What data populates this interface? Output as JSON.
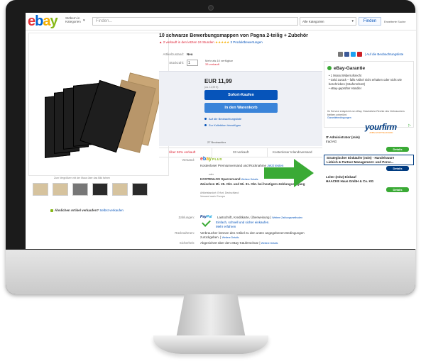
{
  "header": {
    "logo": {
      "e": "e",
      "b": "b",
      "a": "a",
      "y": "y"
    },
    "categories_label": "Stöbern in Kategorien",
    "search_placeholder": "Finden...",
    "category_select": "Alle Kategorien",
    "find_button": "Finden",
    "advanced_search": "Erweiterte Suche"
  },
  "gallery": {
    "hint": "Zum Vergrößern mit der Maus über das Bild fahren",
    "sell_text": "Ähnlichen Artikel verkaufen?",
    "sell_link": "Selbst verkaufen"
  },
  "listing": {
    "title": "10 schwarze Bewerbungsmappen von Pagna 2-teilig + Zubehör",
    "sold_recent": "2 verkauft in den letzten 24 Stunden",
    "stars": "★★★★★",
    "reviews_link": "3 Produktbewertungen",
    "condition_label": "Artikelzustand:",
    "condition_value": "Neu",
    "quantity_label": "Stückzahl:",
    "quantity_value": "1",
    "available": "Mehr als 10 verfügbar",
    "sold_count": "33 verkauft",
    "price": "EUR 11,99",
    "approx": "(ca. 11,99 €)",
    "buy_now": "Sofort-Kaufen",
    "add_to_cart": "In den Warenkorb",
    "watchlist": "Auf die Beobachtungsliste",
    "add_collection": "Zur Kollektion hinzufügen",
    "watchers": "27 Beobachter"
  },
  "stats": {
    "sold_percent": "Über 92% verkauft",
    "sold": "33 verkauft",
    "shipping": "Kostenloser Inlandsversand"
  },
  "shipping": {
    "label": "Versand:",
    "plus": "PLUS",
    "premium_text": "Kostenloser Premiumversand und Rücknahme",
    "learn_more": "Jetzt testen",
    "or": "oder",
    "free_standard": "KOSTENLOS  Sparversand",
    "details": "Weitere Details",
    "delivery": "Zwischen Mi. 25. Okt. und Mi. 31. Okt. bei heutigem Zahlungseingang",
    "location": "Artikelstandort: Erfurt, Deutschland",
    "ships_to": "Versand nach: Europa"
  },
  "payment": {
    "label": "Zahlungen:",
    "paypal_1": "Pay",
    "paypal_2": "Pal",
    "methods": "Lastschrift,  Kreditkarte,  Überweisung",
    "more": "Weitere Zahlungsmethoden",
    "secure_1": "Einfach, schnell und sicher einkaufen.",
    "secure_2": "Mehr erfahren"
  },
  "returns": {
    "label": "Rücknahmen:",
    "text": "Verbraucher können den Artikel zu den unten angegebenen Bedingungen zurückgeben.",
    "details": "Weitere Details"
  },
  "security": {
    "label": "Sicherheit:",
    "text": "Abgesichert über den eBay-Käuferschutz",
    "details": "Weitere Details"
  },
  "sidebar": {
    "watchlist_link": "Auf die Beobachtungsliste",
    "guarantee_title": "eBay-Garantie",
    "guarantee_items": [
      "• 1 Monat Widerrufsrecht",
      "• Geld zurück – falls Artikel nicht erhalten oder nicht wie beschrieben (Käuferschutz)",
      "• eBay-geprüfter Händler"
    ],
    "guarantee_footer": "Ihr Service entspricht von eBay. Gesetzliche Rechte des Verbrauchers bleiben unberührt.",
    "guarantee_link": "Garantiebedingungen",
    "ad_logo": "yourfirm",
    "ad_sub": "JOBS IM MITTELSTAND",
    "jobs": [
      {
        "title": "IT-Administrator (m/w)",
        "company": "trad AG",
        "button": "Details"
      },
      {
        "title": "Strategischer Einkäufer (m/w) - Handelsware",
        "company": "Liebich & Partner Management- und Perso...",
        "button": "Details"
      },
      {
        "title": "Leiter (m/w) Einkauf",
        "company": "HAACKE Haus GmbH & Co. KG",
        "button": "Details"
      }
    ]
  },
  "colors": {
    "ebay_red": "#e53238",
    "ebay_blue": "#0064d2",
    "ebay_yellow": "#f5af02",
    "ebay_green": "#86b817",
    "buy_button": "#0654ba",
    "arrow_green": "#3aaa35",
    "ad_navy": "#003b80"
  }
}
